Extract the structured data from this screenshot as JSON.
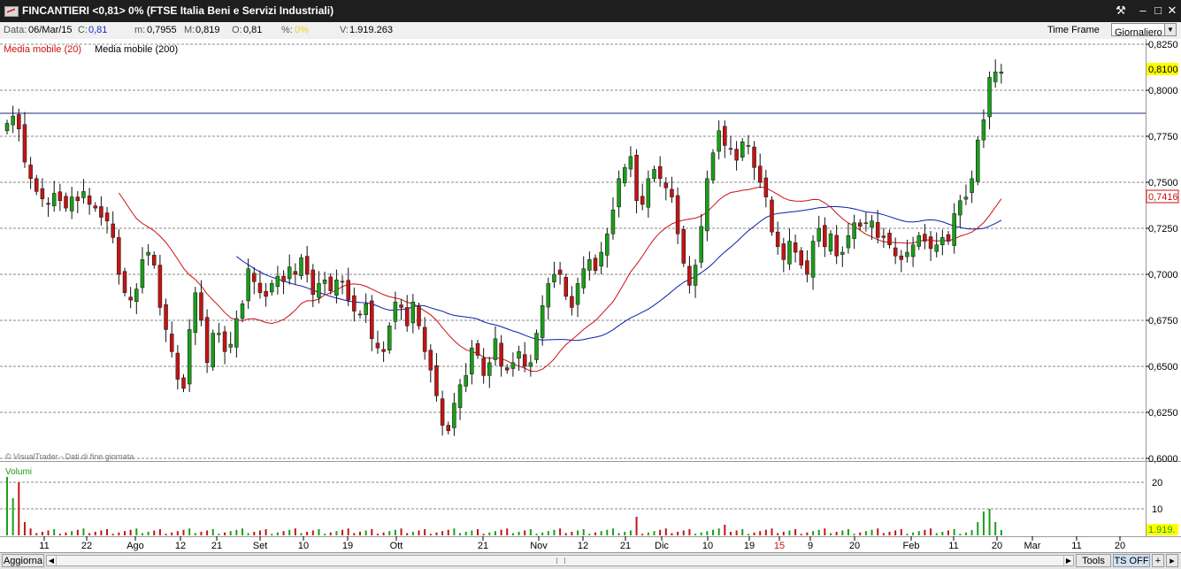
{
  "window": {
    "title": "FINCANTIERI <0,81> 0%  (FTSE Italia Beni e Servizi Industriali)",
    "buttons": [
      "⚒",
      "–",
      "□",
      "✕"
    ]
  },
  "info": {
    "date_label": "Data:",
    "date": "06/Mar/15",
    "close_label": "C:",
    "close": "0,81",
    "min_label": "m:",
    "min": "0,7955",
    "max_label": "M:",
    "max": "0,819",
    "open_label": "O:",
    "open": "0,81",
    "pct_label": "%:",
    "pct": "0%",
    "vol_label": "V:",
    "vol": "1.919.263",
    "timeframe_label": "Time Frame",
    "timeframe_value": "Giornaliero"
  },
  "legend": {
    "ma20": "Media mobile (20)",
    "ma200": "Media mobile (200)"
  },
  "watermark": "VisualTrader - Dati di fine giornata",
  "volume_label": "Volumi",
  "price_axis": [
    "0,8250",
    "0,8000",
    "0,7750",
    "0,7500",
    "0,7250",
    "0,7000",
    "0,6750",
    "0,6500",
    "0,6250",
    "0,6000"
  ],
  "price_tag": "0,8100",
  "ma_tag": "0,7416",
  "volume_axis": [
    "20",
    "10"
  ],
  "volume_tag": "1.919.",
  "x_labels": [
    "11",
    "22",
    "Ago",
    "12",
    "21",
    "Set",
    "10",
    "19",
    "Ott",
    "21",
    "Nov",
    "12",
    "21",
    "Dic",
    "10",
    "19",
    "15",
    "9",
    "20",
    "Feb",
    "11",
    "20",
    "Mar",
    "11",
    "20"
  ],
  "bottom": {
    "refresh": "Aggiorna",
    "tools": "Tools",
    "ts": "TS OFF",
    "plus": "+",
    "arrow": "▸"
  },
  "colors": {
    "up": "#1a9e1a",
    "down": "#c31414",
    "ma20": "#cc1111",
    "ma200": "#0a1fa8",
    "hline": "#1a2b7a",
    "tag": "#ffff00"
  },
  "chart_data": {
    "type": "candlestick",
    "y_range": [
      0.6,
      0.825
    ],
    "resistance": 0.7875,
    "x_tick_labels": [
      "11",
      "22",
      "Ago",
      "12",
      "21",
      "Set",
      "10",
      "19",
      "Ott",
      "21",
      "Nov",
      "12",
      "21",
      "Dic",
      "10",
      "19",
      "15",
      "9",
      "20",
      "Feb",
      "11",
      "20",
      "Mar",
      "11",
      "20"
    ],
    "closes": [
      0.782,
      0.786,
      0.779,
      0.761,
      0.752,
      0.745,
      0.741,
      0.738,
      0.744,
      0.74,
      0.736,
      0.742,
      0.74,
      0.745,
      0.738,
      0.736,
      0.731,
      0.729,
      0.72,
      0.7,
      0.69,
      0.686,
      0.692,
      0.708,
      0.712,
      0.705,
      0.682,
      0.67,
      0.658,
      0.643,
      0.638,
      0.67,
      0.69,
      0.675,
      0.652,
      0.668,
      0.668,
      0.658,
      0.662,
      0.676,
      0.684,
      0.703,
      0.696,
      0.69,
      0.688,
      0.695,
      0.699,
      0.696,
      0.704,
      0.7,
      0.709,
      0.7,
      0.689,
      0.695,
      0.697,
      0.691,
      0.697,
      0.696,
      0.686,
      0.68,
      0.678,
      0.684,
      0.665,
      0.66,
      0.658,
      0.672,
      0.685,
      0.682,
      0.672,
      0.685,
      0.672,
      0.658,
      0.648,
      0.634,
      0.618,
      0.615,
      0.63,
      0.64,
      0.645,
      0.66,
      0.656,
      0.645,
      0.652,
      0.665,
      0.65,
      0.648,
      0.652,
      0.658,
      0.65,
      0.652,
      0.668,
      0.683,
      0.695,
      0.7,
      0.7,
      0.688,
      0.682,
      0.695,
      0.703,
      0.708,
      0.702,
      0.712,
      0.722,
      0.735,
      0.752,
      0.758,
      0.764,
      0.74,
      0.738,
      0.752,
      0.757,
      0.752,
      0.747,
      0.742,
      0.722,
      0.706,
      0.694,
      0.705,
      0.726,
      0.752,
      0.766,
      0.778,
      0.77,
      0.768,
      0.762,
      0.772,
      0.77,
      0.758,
      0.75,
      0.742,
      0.723,
      0.715,
      0.708,
      0.718,
      0.712,
      0.705,
      0.7,
      0.718,
      0.725,
      0.715,
      0.722,
      0.71,
      0.712,
      0.721,
      0.728,
      0.726,
      0.728,
      0.729,
      0.72,
      0.72,
      0.716,
      0.71,
      0.708,
      0.712,
      0.716,
      0.721,
      0.718,
      0.714,
      0.716,
      0.72,
      0.718,
      0.733,
      0.74,
      0.742,
      0.752,
      0.773,
      0.784,
      0.807,
      0.81,
      0.81
    ]
  }
}
